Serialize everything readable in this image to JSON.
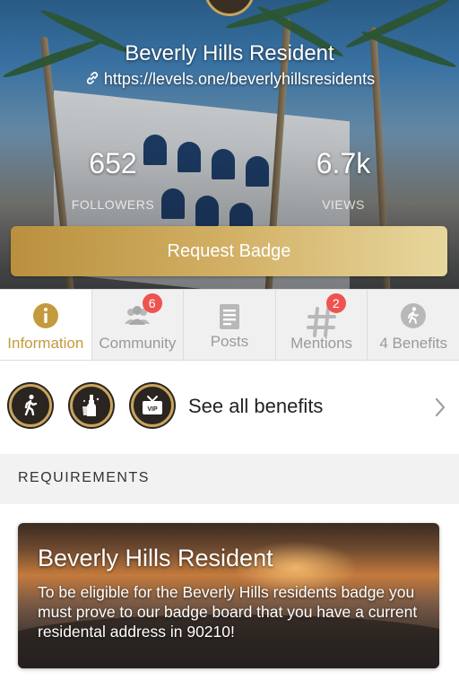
{
  "profile": {
    "name": "Beverly Hills Resident",
    "url": "https://levels.one/beverlyhillsresidents"
  },
  "stats": [
    {
      "value": "652",
      "label": "FOLLOWERS"
    },
    {
      "value": "6.7k",
      "label": "VIEWS"
    }
  ],
  "request_badge_label": "Request Badge",
  "tabs": [
    {
      "label": "Information",
      "icon": "info-icon",
      "active": true
    },
    {
      "label": "Community",
      "icon": "people-icon",
      "badge": "6"
    },
    {
      "label": "Posts",
      "icon": "document-icon"
    },
    {
      "label": "Mentions",
      "icon": "hashtag-icon",
      "badge": "2"
    },
    {
      "label": "4 Benefits",
      "icon": "walking-person-icon"
    }
  ],
  "benefits": {
    "icons": [
      "walking-person-icon",
      "bottle-service-icon",
      "vip-ticket-icon"
    ],
    "see_all_label": "See all benefits"
  },
  "requirements": {
    "header": "REQUIREMENTS",
    "card_title": "Beverly Hills Resident",
    "card_text": "To be eligible for the Beverly Hills residents badge you must prove to our badge board that you have a current residental address in 90210!"
  },
  "colors": {
    "accent_gold": "#c49a3e",
    "badge_red": "#ef5350",
    "tab_inactive": "#9a9a9a"
  }
}
